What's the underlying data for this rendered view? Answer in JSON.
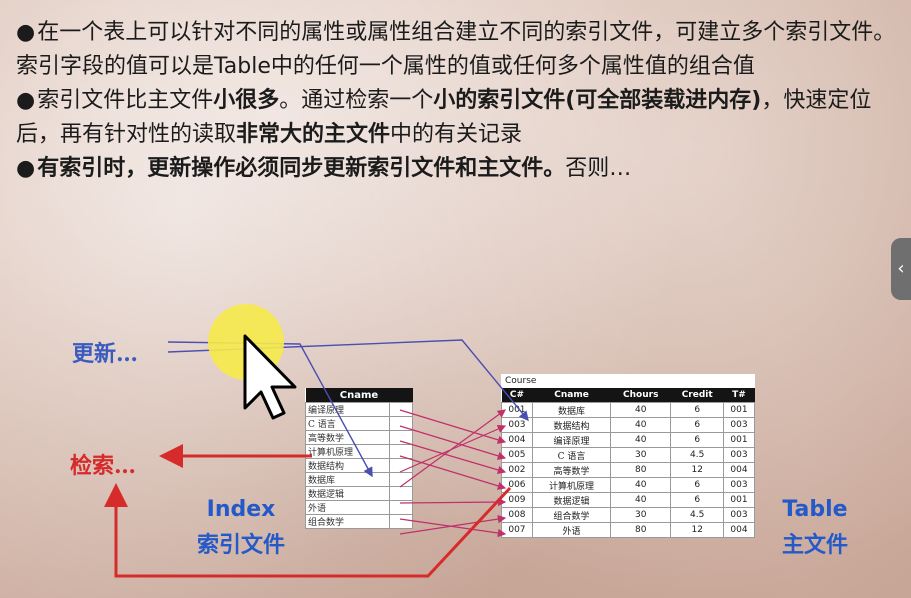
{
  "paragraphs": [
    {
      "bullet": "●",
      "segments": [
        {
          "text": "在一个表上可以针对不同的属性或属性组合建立不同的索引文件，可建立多个索引文件。索引字段的值可以是Table中的任何一个属性的值或任何多个属性值的组合值",
          "bold": false
        }
      ]
    },
    {
      "bullet": "●",
      "segments": [
        {
          "text": "索引文件比主文件",
          "bold": false
        },
        {
          "text": "小很多",
          "bold": true
        },
        {
          "text": "。通过检索一个",
          "bold": false
        },
        {
          "text": "小的索引文件(可全部装载进内存)",
          "bold": true
        },
        {
          "text": "，快速定位后，再有针对性的读取",
          "bold": false
        },
        {
          "text": "非常大的主文件",
          "bold": true
        },
        {
          "text": "中的有关记录",
          "bold": false
        }
      ]
    },
    {
      "bullet": "●",
      "segments": [
        {
          "text": "有索引时，更新操作必须同步更新索引文件和主文件。",
          "bold": true
        },
        {
          "text": "否则…",
          "bold": false
        }
      ]
    }
  ],
  "diagram": {
    "update_label": "更新…",
    "search_label": "检索…",
    "index_caption_en": "Index",
    "index_caption_cn": "索引文件",
    "table_caption_en": "Table",
    "table_caption_cn": "主文件",
    "index": {
      "header": "Cname",
      "rows": [
        "编译原理",
        "C 语言",
        "高等数学",
        "计算机原理",
        "数据结构",
        "数据库",
        "数据逻辑",
        "外语",
        "组合数学"
      ]
    },
    "course": {
      "title": "Course",
      "columns": [
        "C#",
        "Cname",
        "Chours",
        "Credit",
        "T#"
      ],
      "rows": [
        [
          "001",
          "数据库",
          "40",
          "6",
          "001"
        ],
        [
          "003",
          "数据结构",
          "40",
          "6",
          "003"
        ],
        [
          "004",
          "编译原理",
          "40",
          "6",
          "001"
        ],
        [
          "005",
          "C 语言",
          "30",
          "4.5",
          "003"
        ],
        [
          "002",
          "高等数学",
          "80",
          "12",
          "004"
        ],
        [
          "006",
          "计算机原理",
          "40",
          "6",
          "003"
        ],
        [
          "009",
          "数据逻辑",
          "40",
          "6",
          "001"
        ],
        [
          "008",
          "组合数学",
          "30",
          "4.5",
          "003"
        ],
        [
          "007",
          "外语",
          "80",
          "12",
          "004"
        ]
      ]
    },
    "colors": {
      "update": "#3a5bbf",
      "search": "#d62b2b",
      "caption": "#2359c9",
      "pointer_lines": "#c0306a",
      "update_lines": "#4a4fb0"
    }
  },
  "cursor": {
    "icon": "pointer-cursor-icon",
    "highlight_color": "#f6ea4a"
  },
  "side_tab": {
    "icon": "chevron-left-icon",
    "glyph": "‹"
  }
}
